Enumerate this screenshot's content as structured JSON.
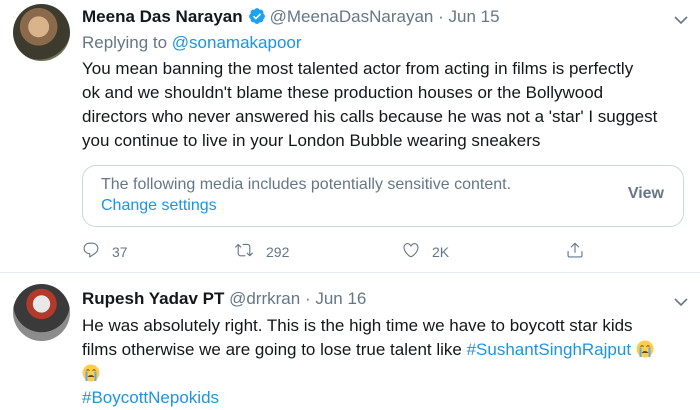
{
  "tweets": [
    {
      "author_name": "Meena Das Narayan",
      "handle": "@MeenaDasNarayan",
      "separator": "·",
      "date": "Jun 15",
      "replying_label": "Replying to",
      "replying_to": "@sonamakapoor",
      "text_lines": [
        "You mean banning the most talented actor from acting in films is perfectly",
        "ok and we shouldn't blame these production houses or the Bollywood",
        "directors who never answered his calls because he was not a 'star' I suggest",
        "you continue to live in your London Bubble wearing sneakers"
      ],
      "media_notice": {
        "message": "The following media includes potentially sensitive content.",
        "change_settings": "Change settings",
        "view": "View"
      },
      "reply_count": "37",
      "retweet_count": "292",
      "like_count": "2K",
      "verified": true
    },
    {
      "author_name": "Rupesh Yadav PT",
      "handle": "@drrkran",
      "separator": "·",
      "date": "Jun 16",
      "line1": "He was absolutely right. This is the high time we have to boycott star kids",
      "line2_text": "films otherwise we are going to lose true talent like",
      "hashtag1": "#SushantSinghRajput",
      "hashtag2": "#BoycottNepokids",
      "emoji": "loudly-crying-face"
    }
  ],
  "colors": {
    "link": "#1b95e0",
    "secondary_text": "#657786",
    "primary_text": "#14171a",
    "verified": "#1da1f2",
    "border": "#ccd6dd"
  }
}
